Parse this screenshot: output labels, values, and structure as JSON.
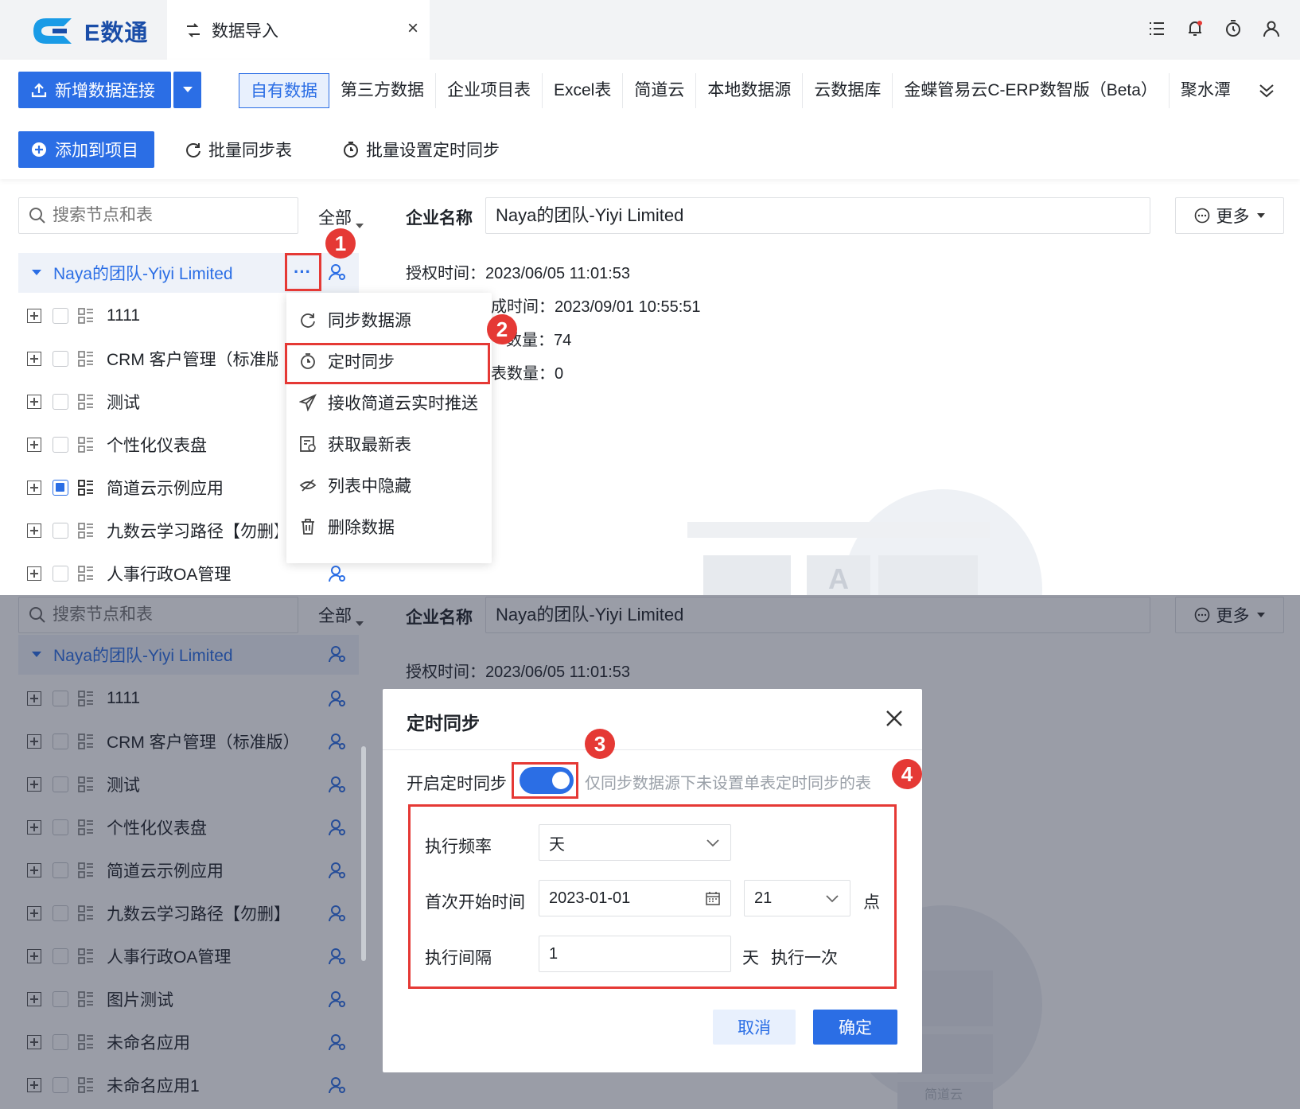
{
  "app": {
    "logo_text": "E数通",
    "tab_title": "数据导入",
    "tab_close": "×"
  },
  "toolbar": {
    "new_connection": "新增数据连接",
    "add_to_project": "添加到项目",
    "batch_sync": "批量同步表",
    "batch_schedule": "批量设置定时同步"
  },
  "source_tabs": [
    "自有数据",
    "第三方数据",
    "企业项目表",
    "Excel表",
    "简道云",
    "本地数据源",
    "云数据库",
    "金蝶管易云C-ERP数智版（Beta）",
    "聚水潭"
  ],
  "tree": {
    "search_placeholder": "搜索节点和表",
    "filter_label": "全部",
    "root": "Naya的团队-Yiyi Limited",
    "more_dots": "···",
    "top_rows": [
      {
        "label": "1111",
        "checked": false
      },
      {
        "label": "CRM 客户管理（标准版）",
        "checked": false
      },
      {
        "label": "测试",
        "checked": false
      },
      {
        "label": "个性化仪表盘",
        "checked": false
      },
      {
        "label": "简道云示例应用",
        "checked": true
      },
      {
        "label": "九数云学习路径【勿删】",
        "checked": false
      },
      {
        "label": "人事行政OA管理",
        "checked": false
      }
    ],
    "bottom_rows": [
      {
        "label": "1111"
      },
      {
        "label": "CRM 客户管理（标准版）"
      },
      {
        "label": "测试"
      },
      {
        "label": "个性化仪表盘"
      },
      {
        "label": "简道云示例应用"
      },
      {
        "label": "九数云学习路径【勿删】"
      },
      {
        "label": "人事行政OA管理"
      },
      {
        "label": "图片测试"
      },
      {
        "label": "未命名应用"
      },
      {
        "label": "未命名应用1"
      }
    ]
  },
  "detail": {
    "company_label": "企业名称",
    "company_value": "Naya的团队-Yiyi Limited",
    "more_label": "更多",
    "auth_time": "授权时间：2023/06/05 11:01:53",
    "sync_time": "成时间：2023/09/01 10:55:51",
    "table_count": "数量：74",
    "hidden_count": "表数量：0"
  },
  "context_menu": [
    "同步数据源",
    "定时同步",
    "接收简道云实时推送",
    "获取最新表",
    "列表中隐藏",
    "删除数据"
  ],
  "badges": [
    "1",
    "2",
    "3",
    "4"
  ],
  "dialog": {
    "title": "定时同步",
    "enable_label": "开启定时同步",
    "enabled": true,
    "hint": "仅同步数据源下未设置单表定时同步的表",
    "freq_label": "执行频率",
    "freq_value": "天",
    "start_label": "首次开始时间",
    "start_date": "2023-01-01",
    "start_hour": "21",
    "hour_unit": "点",
    "interval_label": "执行间隔",
    "interval_value": "1",
    "interval_unit": "天",
    "interval_suffix": "执行一次",
    "cancel": "取消",
    "confirm": "确定"
  },
  "illustration": {
    "letter": "A",
    "watermark": "简道云"
  },
  "colors": {
    "primary": "#2b6ee5",
    "highlight": "#e53935"
  }
}
